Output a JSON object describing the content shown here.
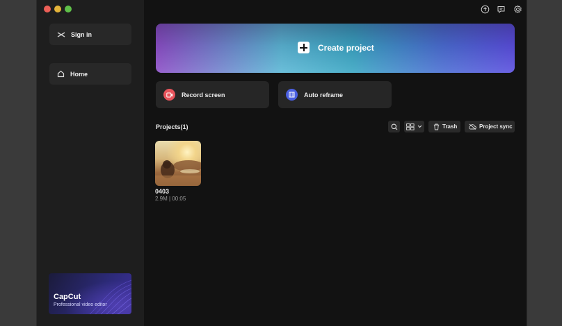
{
  "sidebar": {
    "sign_in_label": "Sign in",
    "home_label": "Home",
    "promo": {
      "title": "CapCut",
      "subtitle": "Professional video editor"
    }
  },
  "main": {
    "create_project_label": "Create project",
    "actions": [
      {
        "label": "Record screen",
        "icon": "record-screen-icon",
        "color": "#e8545c"
      },
      {
        "label": "Auto reframe",
        "icon": "auto-reframe-icon",
        "color": "#4a5fe0"
      }
    ],
    "projects": {
      "title": "Projects(1)",
      "toolbar": {
        "trash_label": "Trash",
        "sync_label": "Project sync"
      },
      "items": [
        {
          "name": "0403",
          "meta": "2.9M | 00:05"
        }
      ]
    }
  },
  "colors": {
    "window_bg": "#121212",
    "sidebar_bg": "#1e1e1e",
    "card_bg": "#262626"
  }
}
